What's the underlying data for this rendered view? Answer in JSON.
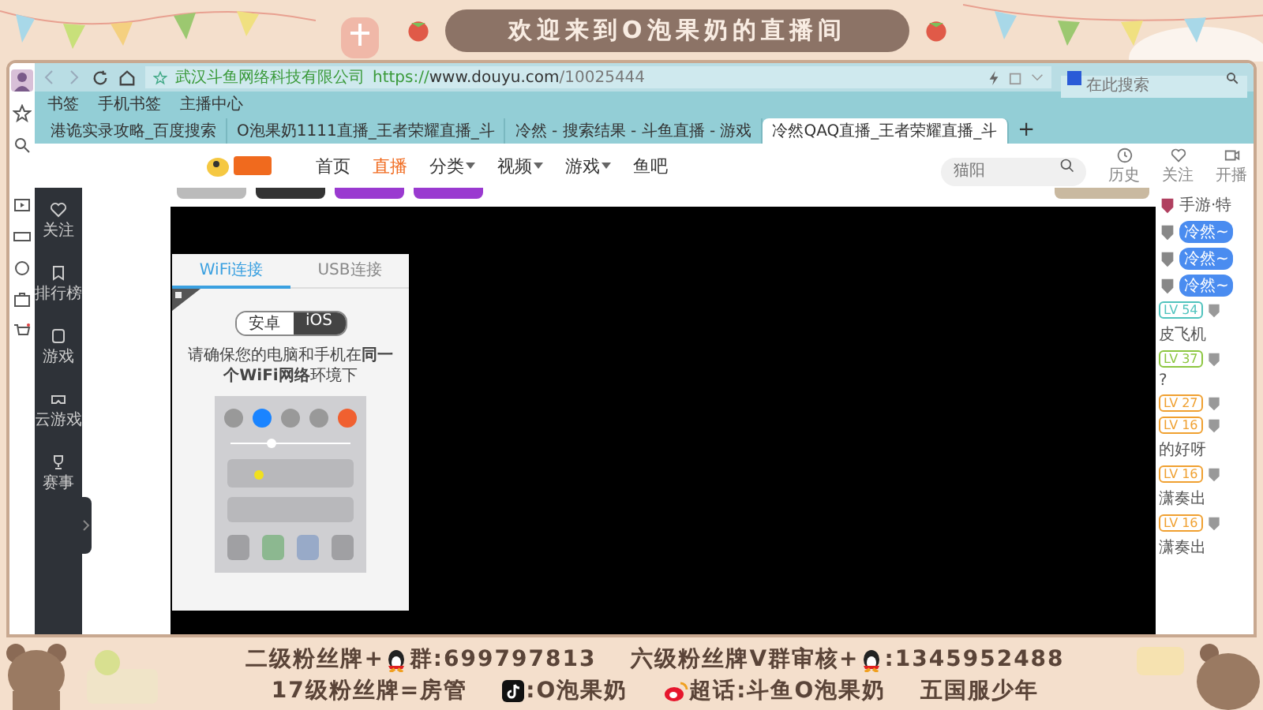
{
  "banner": {
    "title": "欢迎来到O泡果奶的直播间"
  },
  "browser": {
    "address": {
      "site_name": "武汉斗鱼网络科技有限公司",
      "scheme": "https://",
      "host": "www.douyu.com",
      "path": "/10025444"
    },
    "search": {
      "placeholder": "在此搜索"
    },
    "bookmarks": [
      "书签",
      "手机书签",
      "主播中心"
    ],
    "tabs": [
      {
        "title": "港诡实录攻略_百度搜索",
        "selected": false
      },
      {
        "title": "O泡果奶1111直播_王者荣耀直播_斗",
        "selected": false
      },
      {
        "title": "冷然 - 搜索结果 - 斗鱼直播 - 游戏",
        "selected": false
      },
      {
        "title": "冷然QAQ直播_王者荣耀直播_斗",
        "selected": true
      }
    ],
    "new_tab": "+"
  },
  "site": {
    "nav": [
      {
        "label": "首页",
        "selected": false,
        "dropdown": false
      },
      {
        "label": "直播",
        "selected": true,
        "dropdown": false
      },
      {
        "label": "分类",
        "selected": false,
        "dropdown": true
      },
      {
        "label": "视频",
        "selected": false,
        "dropdown": true
      },
      {
        "label": "游戏",
        "selected": false,
        "dropdown": true
      },
      {
        "label": "鱼吧",
        "selected": false,
        "dropdown": false
      }
    ],
    "search": {
      "placeholder": "猫阳"
    },
    "actions": [
      "历史",
      "关注",
      "开播"
    ],
    "sidebar": [
      "关注",
      "排行榜",
      "游戏",
      "云游戏",
      "赛事"
    ]
  },
  "connect_panel": {
    "tabs": [
      {
        "label": "WiFi连接",
        "selected": true
      },
      {
        "label": "USB连接",
        "selected": false
      }
    ],
    "platforms": [
      {
        "label": "安卓",
        "selected": false
      },
      {
        "label": "iOS",
        "selected": true
      }
    ],
    "instruction": "请确保您的电脑和手机在**同一个WiFi网络**环境下"
  },
  "chat": [
    {
      "kind": "medal",
      "text": "手游·特"
    },
    {
      "kind": "pill",
      "text": "冷然~"
    },
    {
      "kind": "pill",
      "text": "冷然~"
    },
    {
      "kind": "pill",
      "text": "冷然~"
    },
    {
      "kind": "level",
      "level": "LV 54",
      "color": "#4fc3bd",
      "text": "皮飞机"
    },
    {
      "kind": "level",
      "level": "LV 37",
      "color": "#8cc63f",
      "text": "?"
    },
    {
      "kind": "level",
      "level": "LV 27",
      "color": "#f0a030"
    },
    {
      "kind": "level",
      "level": "LV 16",
      "color": "#f0a030",
      "text": "的好呀"
    },
    {
      "kind": "level",
      "level": "LV 16",
      "color": "#f0a030",
      "text": "潇奏出"
    },
    {
      "kind": "level",
      "level": "LV 16",
      "color": "#f0a030",
      "text": "潇奏出"
    }
  ],
  "footer": [
    [
      [
        {
          "kind": "text",
          "text": "二级粉丝牌+"
        },
        {
          "kind": "qq"
        },
        {
          "kind": "text",
          "text": "群:699797813"
        }
      ],
      [
        {
          "kind": "text",
          "text": "六级粉丝牌V群审核+"
        },
        {
          "kind": "qq"
        },
        {
          "kind": "text",
          "text": ":1345952488"
        }
      ]
    ],
    [
      [
        {
          "kind": "text",
          "text": "17级粉丝牌=房管"
        }
      ],
      [
        {
          "kind": "tiktok"
        },
        {
          "kind": "text",
          "text": ":O泡果奶"
        }
      ],
      [
        {
          "kind": "weibo"
        },
        {
          "kind": "text",
          "text": "超话:斗鱼O泡果奶"
        }
      ],
      [
        {
          "kind": "text",
          "text": "五国服少年"
        }
      ]
    ]
  ]
}
